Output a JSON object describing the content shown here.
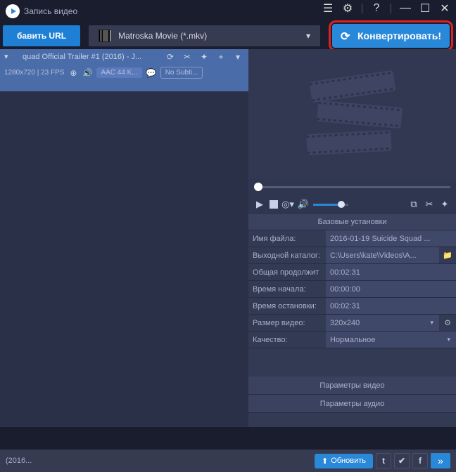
{
  "titlebar": {
    "title": "Запись видео"
  },
  "toolbar": {
    "url_label": "бавить URL",
    "format_label": "Matroska Movie (*.mkv)",
    "convert_label": "Конвертировать!"
  },
  "file": {
    "name": "quad Official Trailer #1 (2016) - J...",
    "meta": "1280x720 | 23 FPS",
    "audio_pill": "AAC 44 K...",
    "subtitle_pill": "No Subti..."
  },
  "settings": {
    "header": "Базовые установки",
    "rows": [
      {
        "label": "Имя файла:",
        "value": "2016-01-19 Suicide Squad ...",
        "type": "text"
      },
      {
        "label": "Выходной каталог:",
        "value": "C:\\Users\\kate\\Videos\\A...",
        "type": "folder"
      },
      {
        "label": "Общая продолжит",
        "value": "00:02:31",
        "type": "plain"
      },
      {
        "label": "Время начала:",
        "value": "00:00:00",
        "type": "plain"
      },
      {
        "label": "Время остановки:",
        "value": "00:02:31",
        "type": "plain"
      },
      {
        "label": "Размер видео:",
        "value": "320x240",
        "type": "dropdown_gear"
      },
      {
        "label": "Качество:",
        "value": "Нормальное",
        "type": "dropdown"
      }
    ],
    "params_video": "Параметры видео",
    "params_audio": "Параметры аудио"
  },
  "footer": {
    "text": "(2016...",
    "update_label": "Обновить"
  },
  "icons": {
    "play_small": "▶",
    "camera": "◎▾",
    "volume": "🔊",
    "link": "⧉",
    "scissors": "✂",
    "magic": "✦",
    "refresh": "⟳",
    "plus": "+",
    "gear": "⚙",
    "help": "?",
    "minimize": "—",
    "maximize": "☐",
    "close": "✕",
    "list": "☰",
    "folder": "📁",
    "crosshair": "⊕",
    "speech": "💬",
    "tw": "t",
    "vk": "✔",
    "fb": "f",
    "more": "»",
    "down": "▾",
    "convert_ic": "⟳",
    "upload": "⬆"
  }
}
